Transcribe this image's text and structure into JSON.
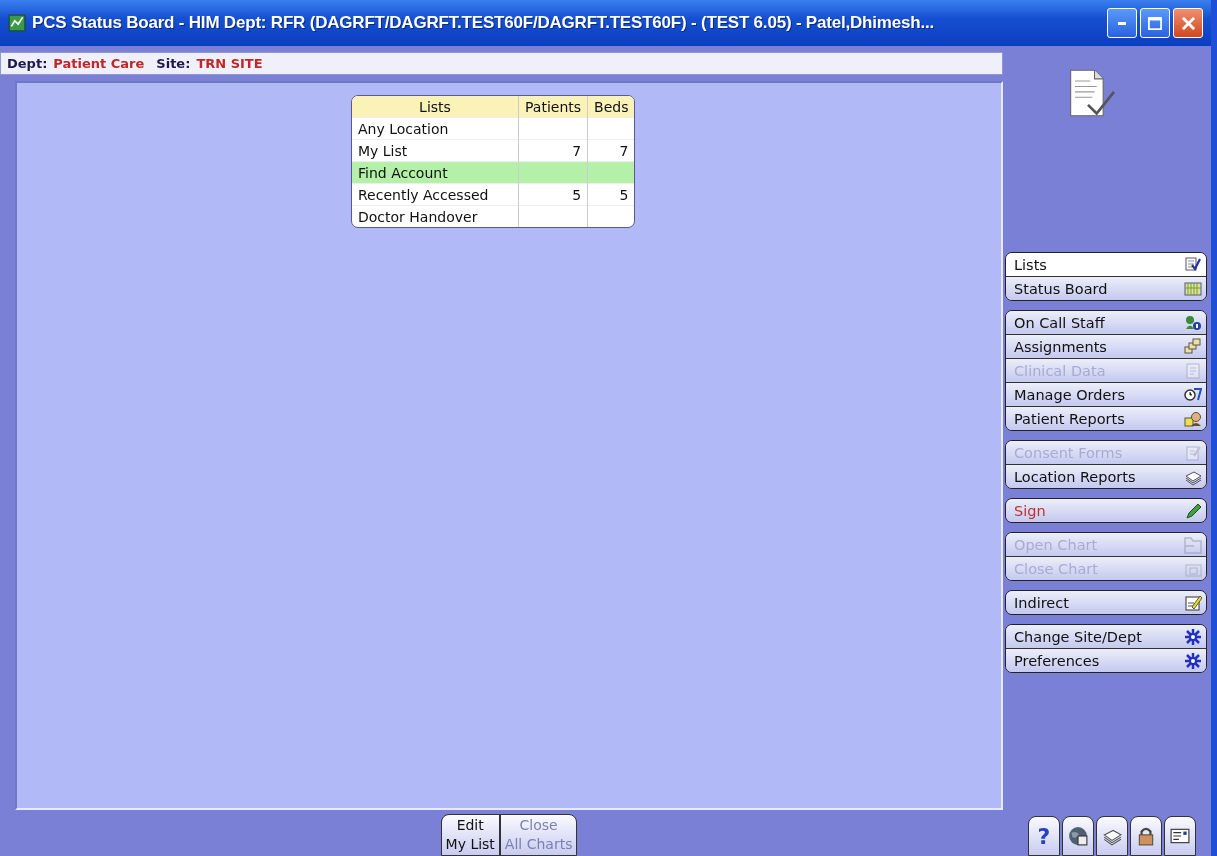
{
  "window": {
    "title": "PCS Status Board - HIM Dept: RFR (DAGRFT/DAGRFT.TEST60F/DAGRFT.TEST60F) - (TEST 6.05) - Patel,Dhimesh..."
  },
  "header": {
    "dept_label": "Dept:",
    "dept": "Patient Care",
    "site_label": "Site:",
    "site": "TRN SITE"
  },
  "lists_table": {
    "columns": [
      "Lists",
      "Patients",
      "Beds"
    ],
    "rows": [
      {
        "cells": [
          "Any Location",
          "",
          ""
        ],
        "selected": false
      },
      {
        "cells": [
          "My List",
          "7",
          "7"
        ],
        "selected": false
      },
      {
        "cells": [
          "Find Account",
          "",
          ""
        ],
        "selected": true
      },
      {
        "cells": [
          "Recently Accessed",
          "5",
          "5"
        ],
        "selected": false
      },
      {
        "cells": [
          "Doctor Handover",
          "",
          ""
        ],
        "selected": false
      }
    ]
  },
  "sidebar": {
    "groups": [
      {
        "items": [
          {
            "label": "Lists",
            "selected": true,
            "disabled": false,
            "alert": false
          },
          {
            "label": "Status Board",
            "selected": false,
            "disabled": false,
            "alert": false
          }
        ]
      },
      {
        "items": [
          {
            "label": "On Call Staff",
            "selected": false,
            "disabled": false,
            "alert": false
          },
          {
            "label": "Assignments",
            "selected": false,
            "disabled": false,
            "alert": false
          },
          {
            "label": "Clinical Data",
            "selected": false,
            "disabled": true,
            "alert": false
          },
          {
            "label": "Manage Orders",
            "selected": false,
            "disabled": false,
            "alert": false
          },
          {
            "label": "Patient Reports",
            "selected": false,
            "disabled": false,
            "alert": false
          }
        ]
      },
      {
        "items": [
          {
            "label": "Consent Forms",
            "selected": false,
            "disabled": true,
            "alert": false
          },
          {
            "label": "Location Reports",
            "selected": false,
            "disabled": false,
            "alert": false
          }
        ]
      },
      {
        "items": [
          {
            "label": "Sign",
            "selected": false,
            "disabled": false,
            "alert": true
          }
        ]
      },
      {
        "items": [
          {
            "label": "Open Chart",
            "selected": false,
            "disabled": true,
            "alert": false
          },
          {
            "label": "Close Chart",
            "selected": false,
            "disabled": true,
            "alert": false
          }
        ]
      },
      {
        "items": [
          {
            "label": "Indirect",
            "selected": false,
            "disabled": false,
            "alert": false
          }
        ]
      },
      {
        "items": [
          {
            "label": "Change Site/Dept",
            "selected": false,
            "disabled": false,
            "alert": false
          },
          {
            "label": "Preferences",
            "selected": false,
            "disabled": false,
            "alert": false
          }
        ]
      }
    ]
  },
  "bottom_buttons": [
    {
      "label": "Edit\nMy List",
      "disabled": false
    },
    {
      "label": "Close\nAll Charts",
      "disabled": true
    }
  ],
  "status_icons": [
    {
      "label": "?"
    }
  ]
}
